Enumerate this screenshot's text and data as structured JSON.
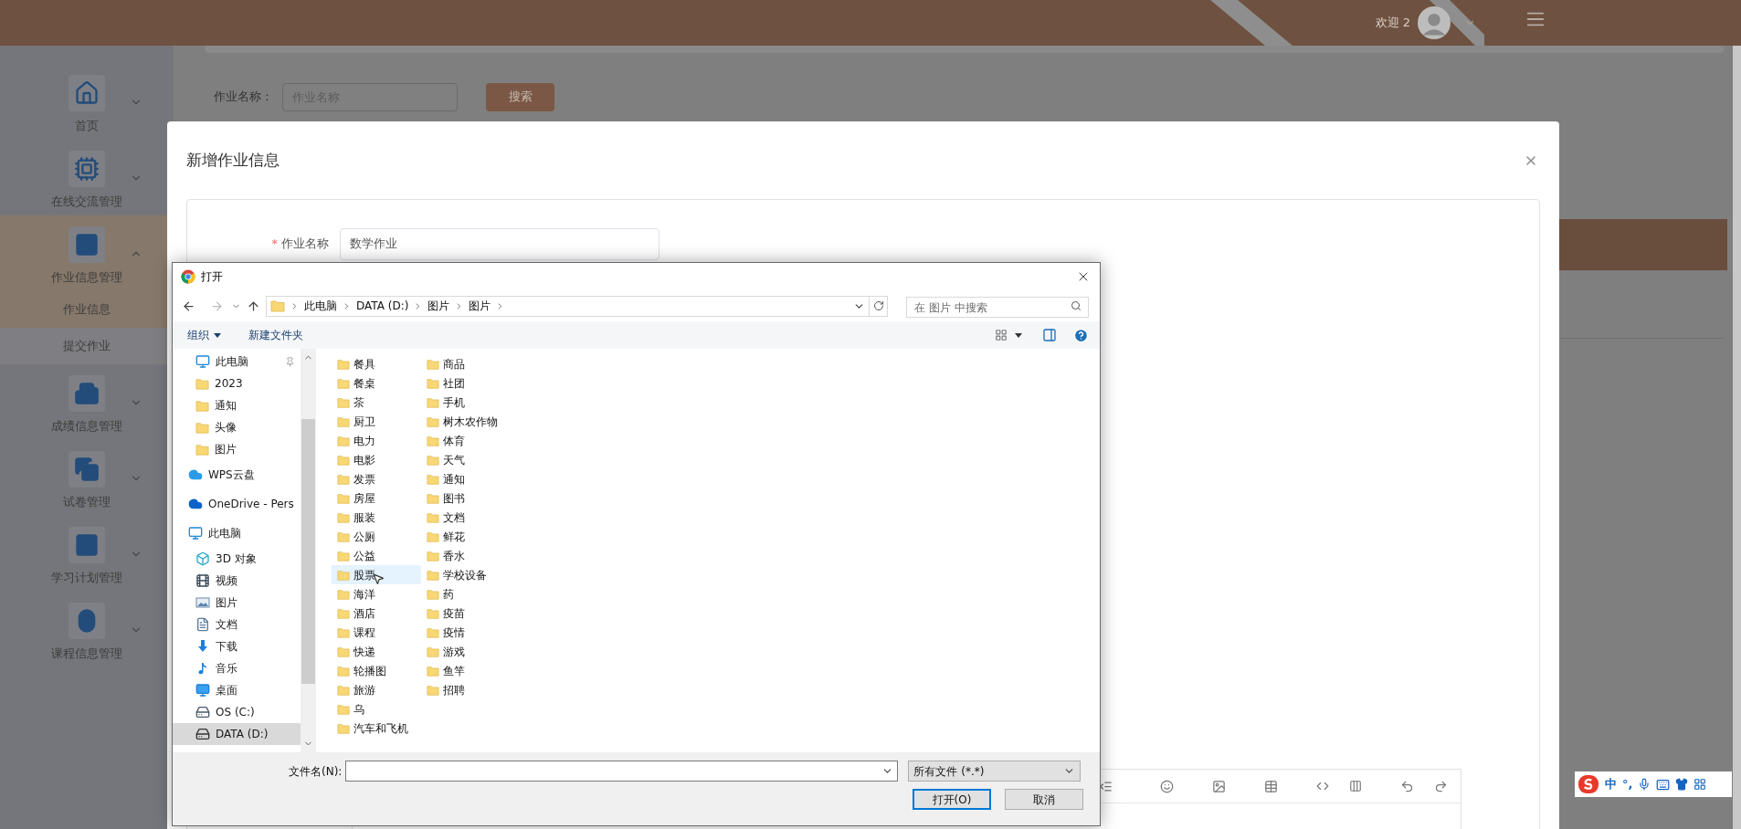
{
  "header": {
    "welcome": "欢迎 2"
  },
  "sidebar": {
    "items": [
      {
        "label": "首页",
        "kind": "home",
        "expanded": false
      },
      {
        "label": "在线交流管理",
        "kind": "chip",
        "expanded": false
      },
      {
        "label": "作业信息管理",
        "kind": "panel",
        "expanded": true,
        "children": [
          {
            "label": "作业信息",
            "selected": true
          },
          {
            "label": "提交作业",
            "selected": false
          }
        ]
      },
      {
        "label": "成绩信息管理",
        "kind": "building",
        "expanded": false
      },
      {
        "label": "试卷管理",
        "kind": "copy",
        "expanded": false
      },
      {
        "label": "学习计划管理",
        "kind": "columns",
        "expanded": false
      },
      {
        "label": "课程信息管理",
        "kind": "mouse",
        "expanded": false
      }
    ]
  },
  "search": {
    "label": "作业名称：",
    "placeholder": "作业名称",
    "button": "搜索"
  },
  "modal": {
    "title": "新增作业信息",
    "field": {
      "label": "作业名称",
      "required_mark": "*",
      "value": "数学作业"
    }
  },
  "file_dialog": {
    "title": "打开",
    "breadcrumb": [
      "此电脑",
      "DATA (D:)",
      "图片",
      "图片"
    ],
    "search_placeholder": "在 图片 中搜索",
    "toolbar": [
      {
        "label": "组织",
        "dropdown": true
      },
      {
        "label": "新建文件夹",
        "dropdown": false
      }
    ],
    "quick_access": [
      {
        "label": "此电脑",
        "kind": "pc",
        "pinned": true
      },
      {
        "label": "2023",
        "kind": "folder",
        "pinned": false
      },
      {
        "label": "通知",
        "kind": "folder",
        "pinned": false
      },
      {
        "label": "头像",
        "kind": "folder",
        "pinned": false
      },
      {
        "label": "图片",
        "kind": "folder",
        "pinned": false
      }
    ],
    "locations": [
      {
        "label": "WPS云盘",
        "kind": "cloud",
        "selected": false
      },
      {
        "label": "OneDrive - Pers",
        "kind": "onedrive",
        "selected": false
      },
      {
        "label": "此电脑",
        "kind": "pc",
        "selected": false,
        "children": [
          {
            "label": "3D 对象",
            "kind": "cube",
            "selected": false
          },
          {
            "label": "视频",
            "kind": "video",
            "selected": false
          },
          {
            "label": "图片",
            "kind": "image",
            "selected": false
          },
          {
            "label": "文档",
            "kind": "doc",
            "selected": false
          },
          {
            "label": "下载",
            "kind": "download",
            "selected": false
          },
          {
            "label": "音乐",
            "kind": "music",
            "selected": false
          },
          {
            "label": "桌面",
            "kind": "desktop",
            "selected": false
          },
          {
            "label": "OS (C:)",
            "kind": "osdrive",
            "selected": false
          },
          {
            "label": "DATA (D:)",
            "kind": "drive",
            "selected": true
          }
        ]
      }
    ],
    "files": [
      {
        "name": "餐具",
        "selected": false
      },
      {
        "name": "餐桌",
        "selected": false
      },
      {
        "name": "茶",
        "selected": false
      },
      {
        "name": "厨卫",
        "selected": false
      },
      {
        "name": "电力",
        "selected": false
      },
      {
        "name": "电影",
        "selected": false
      },
      {
        "name": "发票",
        "selected": false
      },
      {
        "name": "房屋",
        "selected": false
      },
      {
        "name": "服装",
        "selected": false
      },
      {
        "name": "公厕",
        "selected": false
      },
      {
        "name": "公益",
        "selected": false
      },
      {
        "name": "股票",
        "selected": true
      },
      {
        "name": "海洋",
        "selected": false
      },
      {
        "name": "酒店",
        "selected": false
      },
      {
        "name": "课程",
        "selected": false
      },
      {
        "name": "快递",
        "selected": false
      },
      {
        "name": "轮播图",
        "selected": false
      },
      {
        "name": "旅游",
        "selected": false
      },
      {
        "name": "乌",
        "selected": false
      },
      {
        "name": "汽车和飞机",
        "selected": false
      },
      {
        "name": "商品",
        "selected": false
      },
      {
        "name": "社团",
        "selected": false
      },
      {
        "name": "手机",
        "selected": false
      },
      {
        "name": "树木农作物",
        "selected": false
      },
      {
        "name": "体育",
        "selected": false
      },
      {
        "name": "天气",
        "selected": false
      },
      {
        "name": "通知",
        "selected": false
      },
      {
        "name": "图书",
        "selected": false
      },
      {
        "name": "文档",
        "selected": false
      },
      {
        "name": "鲜花",
        "selected": false
      },
      {
        "name": "香水",
        "selected": false
      },
      {
        "name": "学校设备",
        "selected": false
      },
      {
        "name": "药",
        "selected": false
      },
      {
        "name": "疫苗",
        "selected": false
      },
      {
        "name": "疫情",
        "selected": false
      },
      {
        "name": "游戏",
        "selected": false
      },
      {
        "name": "鱼竿",
        "selected": false
      },
      {
        "name": "招聘",
        "selected": false
      }
    ],
    "filename_label": "文件名(N):",
    "filter": "所有文件 (*.*)",
    "buttons": [
      {
        "label": "打开(O)",
        "kind": "primary"
      },
      {
        "label": "取消",
        "kind": "normal"
      }
    ]
  },
  "ime": {
    "items": [
      "中",
      "°,"
    ]
  }
}
